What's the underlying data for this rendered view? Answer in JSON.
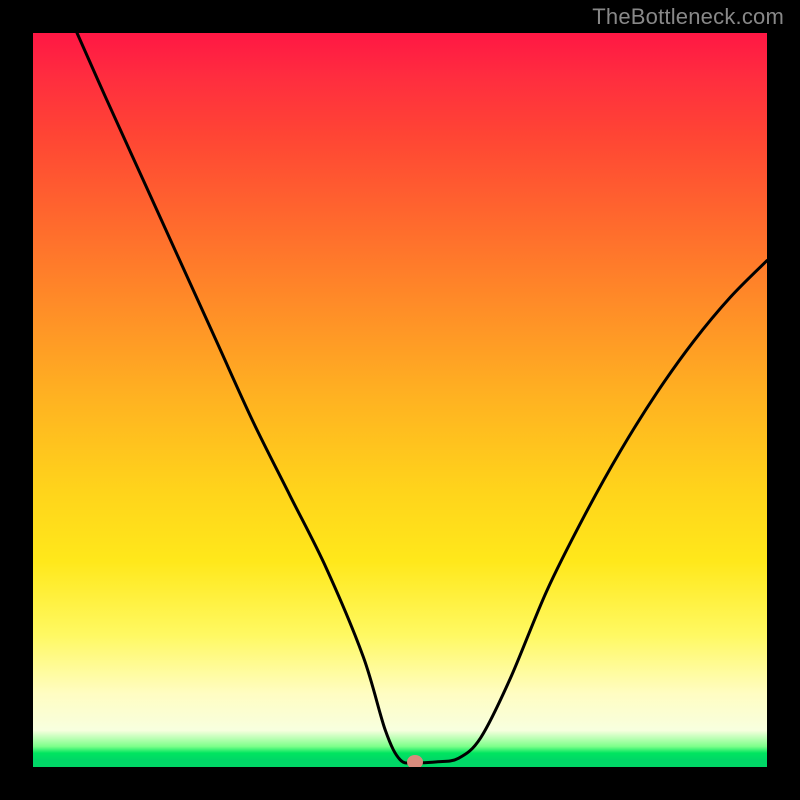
{
  "watermark": "TheBottleneck.com",
  "chart_data": {
    "type": "line",
    "title": "",
    "xlabel": "",
    "ylabel": "",
    "xlim": [
      0,
      100
    ],
    "ylim": [
      0,
      100
    ],
    "grid": false,
    "series": [
      {
        "name": "bottleneck-curve",
        "x": [
          6,
          10,
          15,
          20,
          25,
          30,
          35,
          40,
          45,
          48,
          50,
          52,
          55,
          58,
          61,
          65,
          70,
          75,
          80,
          85,
          90,
          95,
          100
        ],
        "y": [
          100,
          91,
          80,
          69,
          58,
          47,
          37,
          27,
          15,
          5,
          1,
          0.6,
          0.7,
          1.2,
          4,
          12,
          24,
          34,
          43,
          51,
          58,
          64,
          69
        ]
      }
    ],
    "marker": {
      "name": "optimum-point",
      "x": 52,
      "y": 0.7
    },
    "gradient_colors": {
      "top": "#ff1744",
      "mid_high": "#ff8f27",
      "mid": "#ffe81b",
      "mid_low": "#fffdc2",
      "bottom": "#00d766"
    }
  }
}
